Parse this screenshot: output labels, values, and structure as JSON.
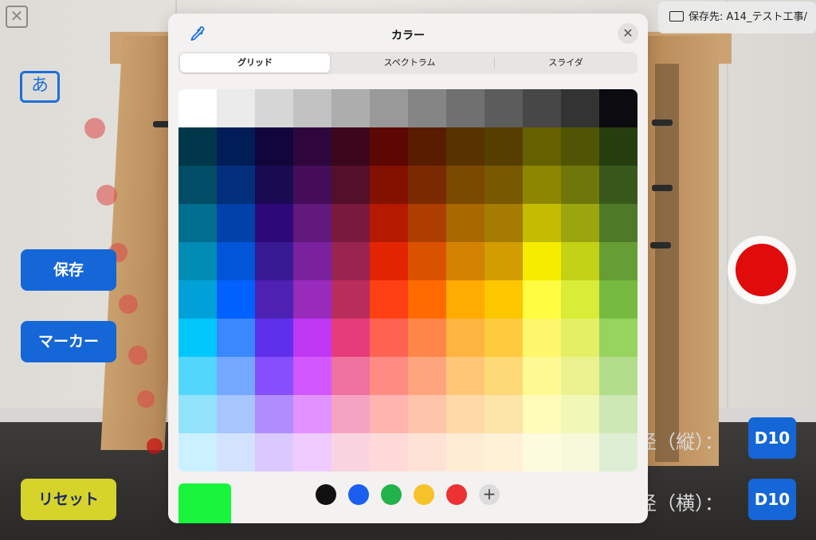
{
  "save_destination": {
    "label": "保存先: A14_テスト工事/"
  },
  "kana_button": {
    "label": "あ"
  },
  "buttons": {
    "save": "保存",
    "marker": "マーカー",
    "reset": "リセット"
  },
  "dimensions": [
    {
      "label": "径（縦）：",
      "value": "D10"
    },
    {
      "label": "径（横）：",
      "value": "D10"
    }
  ],
  "picker": {
    "title": "カラー",
    "tabs": [
      {
        "label": "グリッド",
        "active": true
      },
      {
        "label": "スペクトラム",
        "active": false
      },
      {
        "label": "スライダ",
        "active": false
      }
    ],
    "current_color": "#19f43c",
    "favorites": [
      "#111111",
      "#1a5ff0",
      "#22b24c",
      "#f5c22a",
      "#ec3232"
    ],
    "grid_colors": [
      [
        "#ffffff",
        "#ebebeb",
        "#d6d6d6",
        "#c2c2c2",
        "#adadad",
        "#999999",
        "#858585",
        "#707070",
        "#5c5c5c",
        "#474747",
        "#333333",
        "#0b0b10"
      ],
      [
        "#00374a",
        "#011d57",
        "#11053b",
        "#2e063d",
        "#3c071b",
        "#5c0701",
        "#5a1c00",
        "#583300",
        "#563d00",
        "#666100",
        "#4f5504",
        "#263e0f"
      ],
      [
        "#004d65",
        "#012f7b",
        "#1a0a52",
        "#450d59",
        "#551029",
        "#831100",
        "#7b2900",
        "#7a4a00",
        "#785800",
        "#8d8602",
        "#6f760a",
        "#38571a"
      ],
      [
        "#016e8f",
        "#0042a9",
        "#2c0977",
        "#61187c",
        "#791a3d",
        "#b51a00",
        "#ad3e00",
        "#a96800",
        "#a67b01",
        "#c4bc00",
        "#9ba50e",
        "#4e7a27"
      ],
      [
        "#008cb4",
        "#0056d6",
        "#371a94",
        "#7a219e",
        "#99244f",
        "#e22400",
        "#da5100",
        "#d38301",
        "#d19d01",
        "#f5ec00",
        "#c3d117",
        "#669d34"
      ],
      [
        "#00a1d8",
        "#0061fe",
        "#4d22b2",
        "#982abc",
        "#b92d5d",
        "#ff4015",
        "#ff6a00",
        "#ffab01",
        "#fdc700",
        "#fefb41",
        "#d9ec37",
        "#76bb40"
      ],
      [
        "#01c7fc",
        "#3a87fe",
        "#5e30eb",
        "#be38f3",
        "#e63b7a",
        "#fe6250",
        "#fe8648",
        "#feb43f",
        "#fecb3e",
        "#fff76b",
        "#e4ef65",
        "#96d35f"
      ],
      [
        "#52d6fc",
        "#74a7ff",
        "#864ffe",
        "#d357fe",
        "#ee719e",
        "#ff8c82",
        "#fea57d",
        "#fec777",
        "#fed977",
        "#fff994",
        "#eaf28f",
        "#b1dd8b"
      ],
      [
        "#93e3fc",
        "#a7c6ff",
        "#b18cfe",
        "#e292fe",
        "#f4a4c0",
        "#ffb5af",
        "#ffc5ab",
        "#fed9a8",
        "#fde4a8",
        "#fffbb9",
        "#f1f7b7",
        "#cde8b5"
      ],
      [
        "#cbf0ff",
        "#d3e2ff",
        "#d9c9fe",
        "#efcaff",
        "#f9d3e0",
        "#ffdad8",
        "#ffe2d6",
        "#feecd4",
        "#fef1d5",
        "#fdfbdd",
        "#f6fadb",
        "#deeed4"
      ]
    ]
  }
}
